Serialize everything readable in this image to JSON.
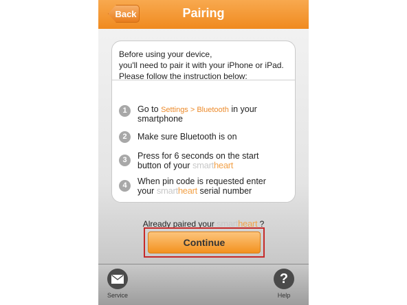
{
  "navbar": {
    "back_label": "Back",
    "title": "Pairing"
  },
  "intro": {
    "line1": "Before using your device,",
    "line2": "you'll need to pair it with your iPhone or iPad.",
    "line3": "Please follow the instruction below:"
  },
  "steps": [
    {
      "num": "1",
      "pre": "Go to",
      "link": "Settings > Bluetooth",
      "post": "in your",
      "line2": "smartphone"
    },
    {
      "num": "2",
      "text": "Make sure Bluetooth is on"
    },
    {
      "num": "3",
      "line1": "Press for 6 seconds on the start",
      "line2_pre": "button of your"
    },
    {
      "num": "4",
      "line1": "When pin code is requested enter",
      "line2_pre": "your",
      "line2_post": "serial number"
    }
  ],
  "brand": {
    "part1": "smart",
    "part2": "heart"
  },
  "paired": {
    "pre": "Already paired your",
    "post": "?"
  },
  "continue_label": "Continue",
  "tabbar": {
    "service_label": "Service",
    "help_label": "Help",
    "service_icon": "envelope-icon",
    "help_icon": "question-icon"
  },
  "colors": {
    "accent": "#f08a1f",
    "brand_light": "#c8c8c8",
    "brand_orange": "#f2a24a"
  }
}
